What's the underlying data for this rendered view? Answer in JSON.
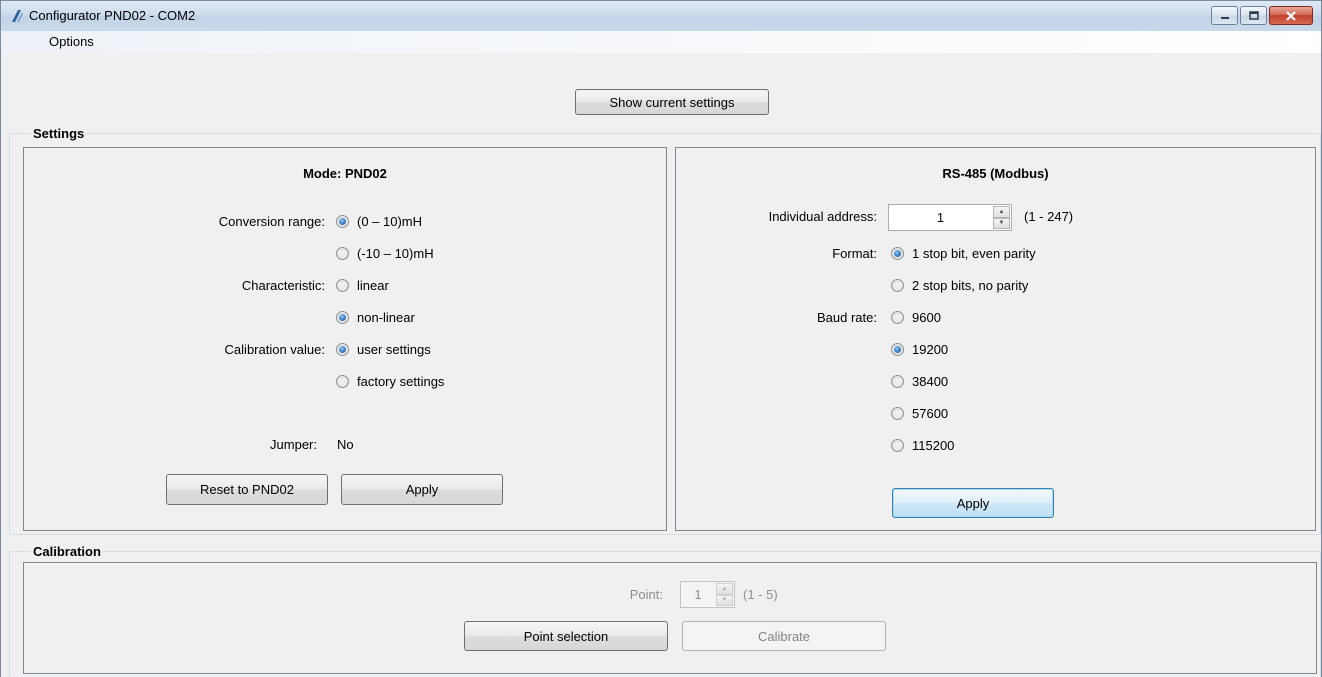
{
  "window": {
    "title": "Configurator PND02 - COM2",
    "icon": "app-logo-icon",
    "controls": [
      "minimize-icon",
      "maximize-icon",
      "close-icon"
    ]
  },
  "menu": {
    "options": "Options"
  },
  "top": {
    "show_settings": "Show current settings"
  },
  "settings": {
    "group_title": "Settings",
    "mode": {
      "title": "Mode: PND02",
      "conversion_label": "Conversion range:",
      "conversion_opt1": "(0 – 10)mH",
      "conversion_opt2": "(-10 – 10)mH",
      "conversion_selected": "(0 – 10)mH",
      "characteristic_label": "Characteristic:",
      "characteristic_opt1": "linear",
      "characteristic_opt2": "non-linear",
      "characteristic_selected": "non-linear",
      "calibration_label": "Calibration value:",
      "calibration_opt1": "user settings",
      "calibration_opt2": "factory settings",
      "calibration_selected": "user settings",
      "jumper_label": "Jumper:",
      "jumper_value": "No",
      "reset_button": "Reset to PND02",
      "apply_button": "Apply"
    },
    "modbus": {
      "title": "RS-485 (Modbus)",
      "address_label": "Individual address:",
      "address_value": "1",
      "address_range": "(1 - 247)",
      "format_label": "Format:",
      "format_opt1": "1 stop bit, even parity",
      "format_opt2": "2 stop bits, no parity",
      "format_selected": "1 stop bit, even parity",
      "baud_label": "Baud rate:",
      "baud_opt1": "9600",
      "baud_opt2": "19200",
      "baud_opt3": "38400",
      "baud_opt4": "57600",
      "baud_opt5": "115200",
      "baud_selected": "19200",
      "apply_button": "Apply"
    }
  },
  "calibration": {
    "group_title": "Calibration",
    "point_label": "Point:",
    "point_value": "1",
    "point_range": "(1 - 5)",
    "point_selection_button": "Point selection",
    "calibrate_button": "Calibrate"
  }
}
